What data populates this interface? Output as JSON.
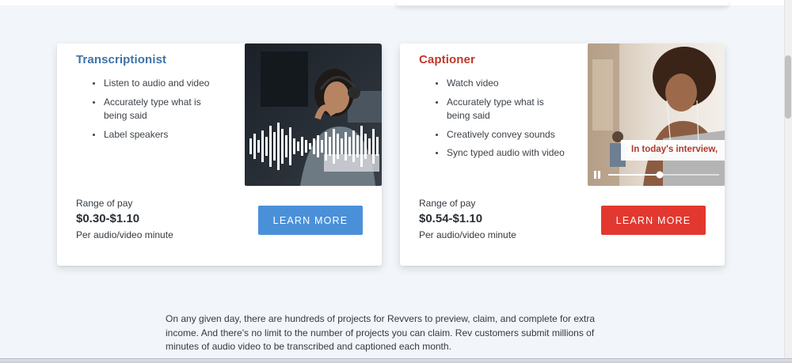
{
  "cards": [
    {
      "title": "Transcriptionist",
      "bullets": [
        "Listen to audio and video",
        "Accurately type what is being said",
        "Label speakers"
      ],
      "pay_label": "Range of pay",
      "pay_value": "$0.30-$1.10",
      "pay_unit": "Per audio/video minute",
      "button_label": "LEARN MORE",
      "accent": "#3f72a6",
      "button_color": "#4a90d9"
    },
    {
      "title": "Captioner",
      "bullets": [
        "Watch video",
        "Accurately type what is being said",
        "Creatively convey sounds",
        "Sync typed audio with video"
      ],
      "pay_label": "Range of pay",
      "pay_value": "$0.54-$1.10",
      "pay_unit": "Per audio/video minute",
      "button_label": "LEARN MORE",
      "caption_text": "In today's interview,",
      "accent": "#c0392b",
      "button_color": "#e2382f"
    }
  ],
  "body_text": "On any given day, there are hundreds of projects for Revvers to preview, claim, and complete for extra income. And there's no limit to the number of projects you can claim. Rev customers submit millions of minutes of audio video to be transcribed and captioned each month.",
  "icons": {
    "transcriptionist_image": "woman-with-headphones-waveform-image",
    "captioner_image": "woman-with-earbuds-video-image",
    "pause": "pause-icon"
  }
}
